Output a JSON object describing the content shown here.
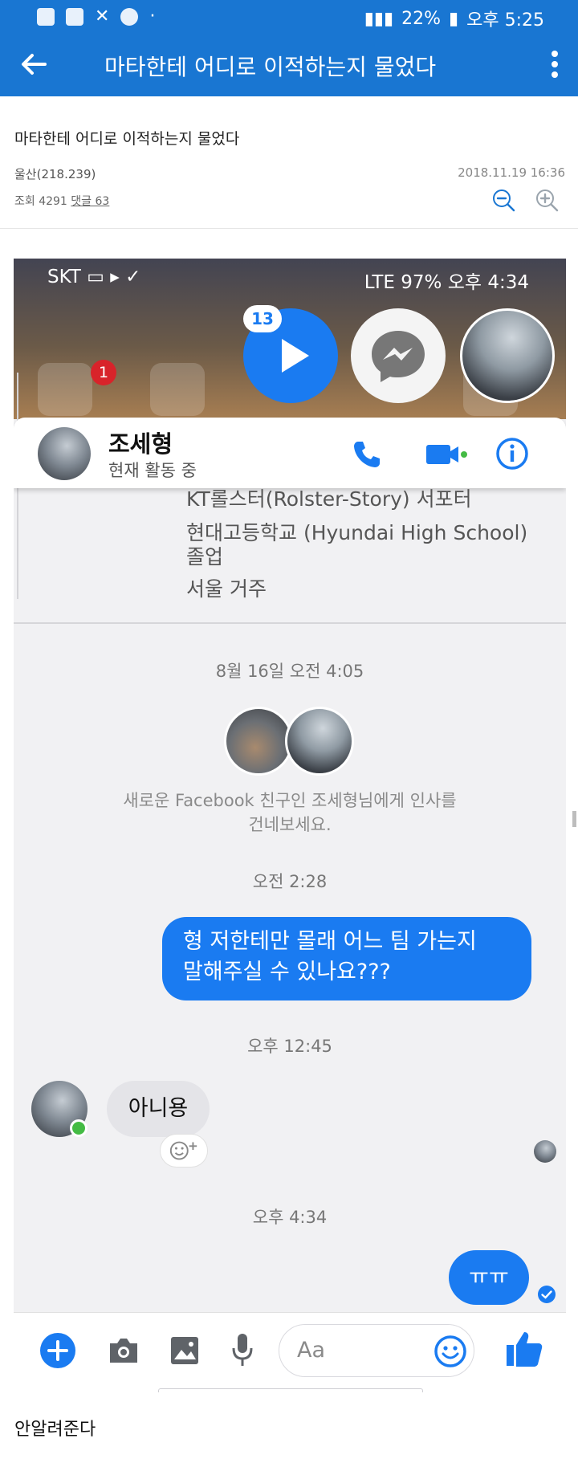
{
  "status_bar": {
    "left_icons": [
      "u-plus-icon",
      "gallery-icon",
      "mute-ring-icon",
      "kakaotalk-icon",
      "dot-icon"
    ],
    "battery": "22%",
    "time": "오후 5:25"
  },
  "app_bar": {
    "title": "마타한테 어디로 이적하는지 물었다"
  },
  "post": {
    "title": "마타한테 어디로 이적하는지 물었다",
    "author": "울산(218.239)",
    "datetime": "2018.11.19 16:36",
    "stats_prefix": "조회 4291 ",
    "comments": "댓글 63",
    "body": "안알려준다"
  },
  "screenshot": {
    "status_left": "SKT",
    "status_right": "LTE 97% 오후 4:34",
    "notification_count": "1",
    "video_count": "13",
    "contact_name": "조세형",
    "contact_status": "현재 활동 중",
    "profile_lines": [
      "KT롤스터(Rolster-Story) 서포터",
      "현대고등학교 (Hyundai High School)",
      "졸업",
      "서울 거주"
    ],
    "time_1": "8월 16일 오전 4:05",
    "greeting_1": "새로운 Facebook 친구인 조세형님에게 인사를",
    "greeting_2": "건네보세요.",
    "time_2": "오전 2:28",
    "msg_out_1": "형 저한테만 몰래 어느 팀 가는지",
    "msg_out_2": "말해주실 수 있나요???",
    "time_3": "오후 12:45",
    "msg_in": "아니용",
    "time_4": "오후 4:34",
    "msg_out_3": "ㅠㅠ",
    "composer_placeholder": "Aa"
  },
  "colors": {
    "app_blue": "#1976d2",
    "messenger_blue": "#1a7bf1",
    "online_green": "#44bb44"
  }
}
